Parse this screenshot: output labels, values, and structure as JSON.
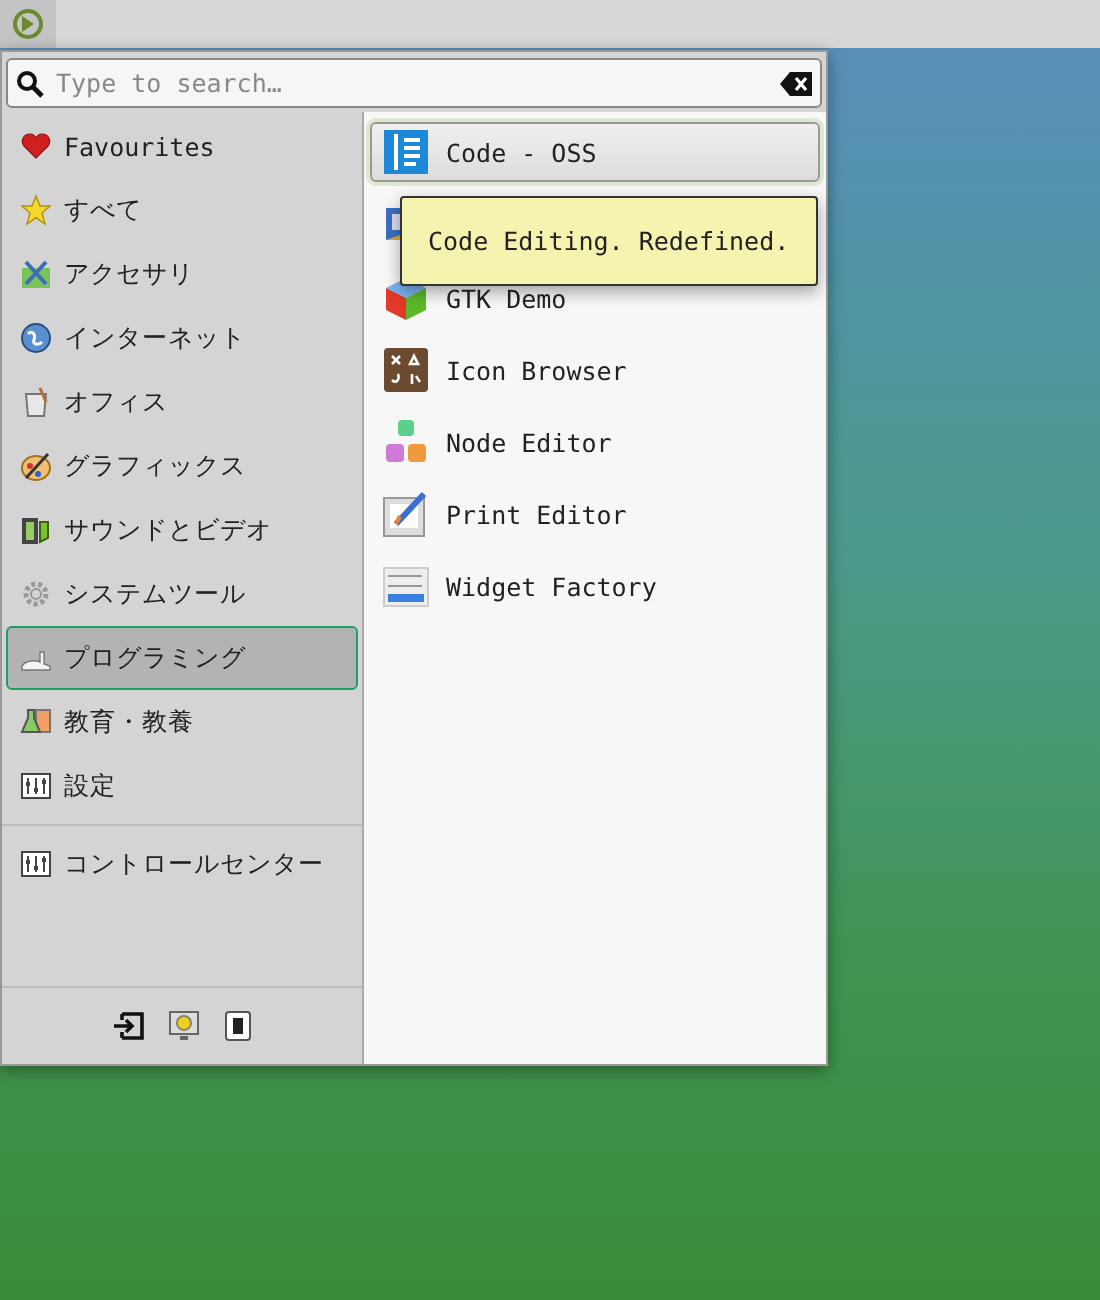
{
  "search": {
    "placeholder": "Type to search…"
  },
  "categories": [
    {
      "label": "Favourites",
      "selected": false
    },
    {
      "label": "すべて",
      "selected": false
    },
    {
      "label": "アクセサリ",
      "selected": false
    },
    {
      "label": "インターネット",
      "selected": false
    },
    {
      "label": "オフィス",
      "selected": false
    },
    {
      "label": "グラフィックス",
      "selected": false
    },
    {
      "label": "サウンドとビデオ",
      "selected": false
    },
    {
      "label": "システムツール",
      "selected": false
    },
    {
      "label": "プログラミング",
      "selected": true
    },
    {
      "label": "教育・教養",
      "selected": false
    },
    {
      "label": "設定",
      "selected": false
    }
  ],
  "control_center": {
    "label": "コントロールセンター"
  },
  "apps": [
    {
      "name": "Code - OSS",
      "selected": true
    },
    {
      "selected": false
    },
    {
      "name": "GTK Demo",
      "selected": false
    },
    {
      "name": "Icon Browser",
      "selected": false
    },
    {
      "name": "Node Editor",
      "selected": false
    },
    {
      "name": "Print Editor",
      "selected": false
    },
    {
      "name": "Widget Factory",
      "selected": false
    }
  ],
  "tooltip": {
    "text": "Code Editing. Redefined."
  }
}
